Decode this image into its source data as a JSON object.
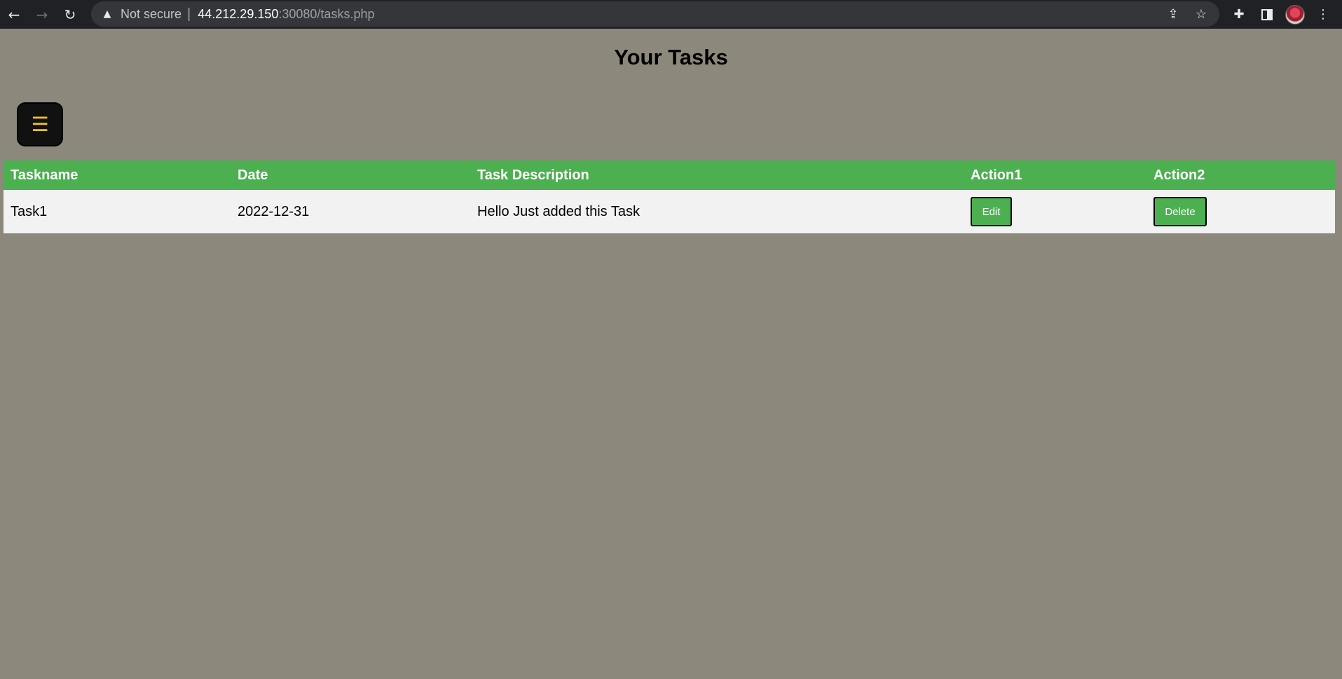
{
  "browser": {
    "security_label": "Not secure",
    "url_host": "44.212.29.150",
    "url_rest": ":30080/tasks.php",
    "icons": {
      "back": "back-arrow-icon",
      "forward": "forward-arrow-icon",
      "reload": "reload-icon",
      "warning": "warning-icon",
      "share": "share-icon",
      "bookmark": "star-icon",
      "extensions": "puzzle-icon",
      "side_panel": "side-panel-icon",
      "profile": "avatar",
      "menu": "kebab-menu-icon"
    }
  },
  "page": {
    "title": "Your Tasks",
    "menu_button_glyph": "☰",
    "colors": {
      "background": "#8c897c",
      "accent": "#4caf50",
      "menu_button_bg": "#111111",
      "menu_glyph": "#f2c417"
    }
  },
  "table": {
    "headers": [
      "Taskname",
      "Date",
      "Task Description",
      "Action1",
      "Action2"
    ],
    "rows": [
      {
        "taskname": "Task1",
        "date": "2022-12-31",
        "description": "Hello Just added this Task",
        "action1": "Edit",
        "action2": "Delete"
      }
    ]
  }
}
